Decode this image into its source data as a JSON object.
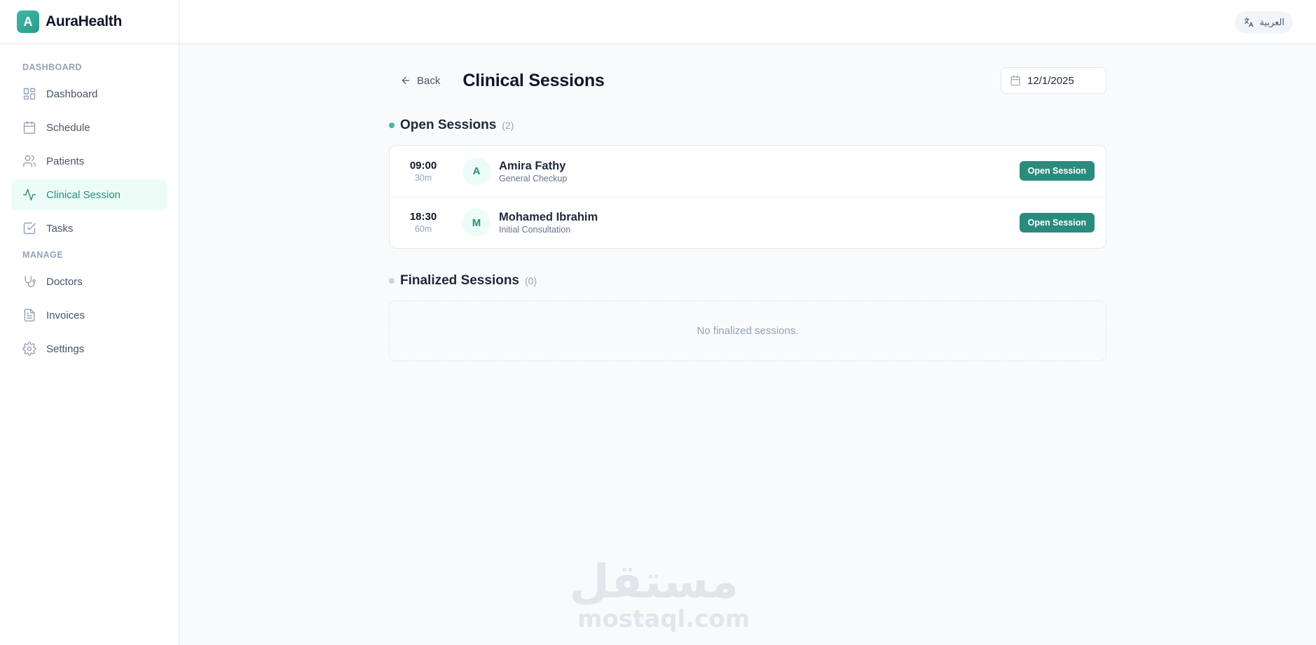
{
  "brand": {
    "logo_letter": "A",
    "name": "AuraHealth"
  },
  "sidebar": {
    "section_dashboard": "DASHBOARD",
    "section_manage": "MANAGE",
    "items": [
      {
        "label": "Dashboard",
        "icon": "dashboard-icon"
      },
      {
        "label": "Schedule",
        "icon": "calendar-icon"
      },
      {
        "label": "Patients",
        "icon": "users-icon"
      },
      {
        "label": "Clinical Session",
        "icon": "activity-icon",
        "active": true
      },
      {
        "label": "Tasks",
        "icon": "checkbox-icon"
      },
      {
        "label": "Doctors",
        "icon": "stethoscope-icon"
      },
      {
        "label": "Invoices",
        "icon": "file-text-icon"
      },
      {
        "label": "Settings",
        "icon": "gear-icon"
      }
    ]
  },
  "topbar": {
    "language_label": "العربية",
    "language_icon": "translate-icon"
  },
  "header": {
    "back_label": "Back",
    "title": "Clinical Sessions",
    "date": "12/1/2025"
  },
  "open_sessions": {
    "title": "Open Sessions",
    "count": "(2)",
    "items": [
      {
        "time": "09:00",
        "duration": "30m",
        "initial": "A",
        "name": "Amira Fathy",
        "type": "General Checkup",
        "action": "Open Session"
      },
      {
        "time": "18:30",
        "duration": "60m",
        "initial": "M",
        "name": "Mohamed Ibrahim",
        "type": "Initial Consultation",
        "action": "Open Session"
      }
    ]
  },
  "finalized_sessions": {
    "title": "Finalized Sessions",
    "count": "(0)",
    "empty_text": "No finalized sessions."
  },
  "watermark": {
    "arabic": "مستقل",
    "latin": "mostaql.com"
  },
  "colors": {
    "accent": "#2a8c7e",
    "accent_light": "#ecfdf8",
    "open_dot": "#3fb9a6",
    "finalized_dot": "#cbd5e1"
  }
}
